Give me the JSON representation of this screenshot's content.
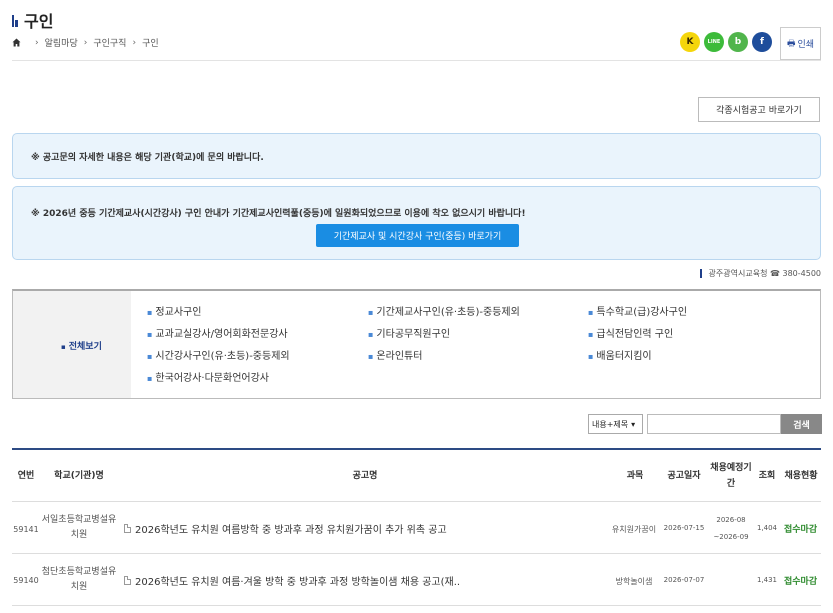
{
  "page": {
    "title": "구인"
  },
  "breadcrumb": {
    "items": [
      "알림마당",
      "구인구직",
      "구인"
    ]
  },
  "share": {
    "kakao": "K",
    "line": "LINE",
    "band": "b",
    "facebook": "f"
  },
  "print": {
    "label": "인쇄"
  },
  "exam_link": {
    "label": "각종시험공고 바로가기"
  },
  "notices": {
    "first": "※ 공고문의 자세한 내용은 해당 기관(학교)에 문의 바랍니다.",
    "second": "※ 2026년 중등 기간제교사(시간강사) 구인 안내가 기간제교사인력풀(중등)에 일원화되었으므로 이용에 착오 없으시기 바랍니다!",
    "button": "기간제교사 및 시간강사 구인(중등) 바로가기"
  },
  "contact": {
    "text": "광주광역시교육청 ☎ 380-4500"
  },
  "categories": {
    "all": "전체보기",
    "items": [
      "정교사구인",
      "기간제교사구인(유·초등)-중등제외",
      "특수학교(급)강사구인",
      "교과교실강사/영어회화전문강사",
      "기타공무직원구인",
      "급식전담인력 구인",
      "시간강사구인(유·초등)-중등제외",
      "온라인튜터",
      "배움터지킴이",
      "한국어강사·다문화언어강사"
    ]
  },
  "search": {
    "select_value": "내용+제목",
    "button": "검색"
  },
  "table": {
    "headers": {
      "no": "연번",
      "school": "학교(기관)명",
      "title": "공고명",
      "subject": "과목",
      "date": "공고일자",
      "period": "채용예정기간",
      "views": "조회",
      "status": "채용현황"
    },
    "rows": [
      {
        "no": "59141",
        "school": "서일초등학교병설유치원",
        "title": "2026학년도 유치원 여름방학 중 방과후 과정 유치원가꿈이 추가 위촉 공고",
        "subject": "유치원가꿈이",
        "date": "2026-07-15",
        "period_start": "2026-08",
        "period_end": "~2026-09",
        "views": "1,404",
        "status": "접수마감"
      },
      {
        "no": "59140",
        "school": "첨단초등학교병설유치원",
        "title": "2026학년도 유치원 여름·겨울 방학 중 방과후 과정 방학놀이샘 채용 공고(재..",
        "subject": "방학놀이샘",
        "date": "2026-07-07",
        "period_start": "",
        "period_end": "",
        "views": "1,431",
        "status": "접수마감"
      }
    ]
  }
}
